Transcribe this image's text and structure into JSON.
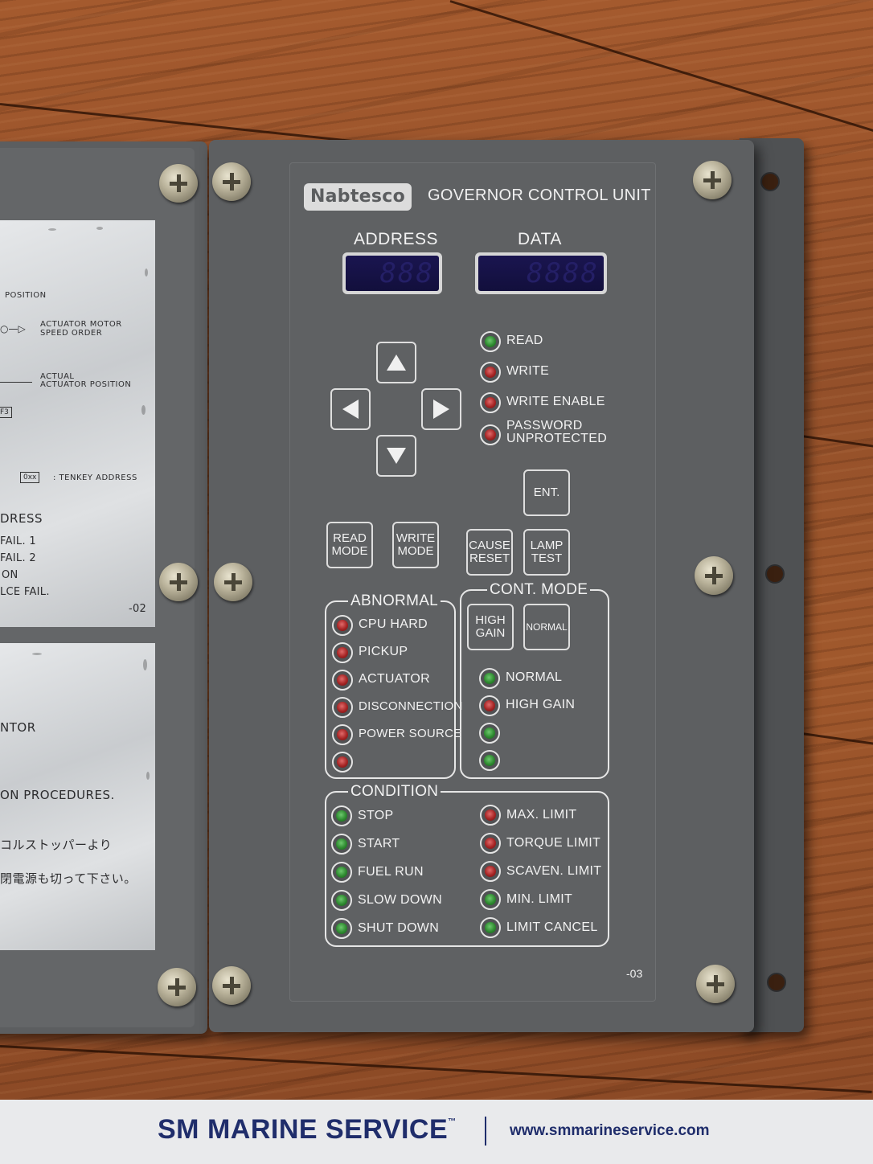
{
  "panel": {
    "brand_logo": "Nabtesco",
    "title": "GOVERNOR CONTROL UNIT",
    "address_label": "ADDRESS",
    "data_label": "DATA",
    "address_digits": "888",
    "data_digits": "8888",
    "panel_code": "-03",
    "status_leds": [
      {
        "label": "READ",
        "color": "green"
      },
      {
        "label": "WRITE",
        "color": "red"
      },
      {
        "label": "WRITE ENABLE",
        "color": "red"
      },
      {
        "label_line1": "PASSWORD",
        "label_line2": "UNPROTECTED",
        "color": "red"
      }
    ],
    "buttons": {
      "ent": "ENT.",
      "read_mode_1": "READ",
      "read_mode_2": "MODE",
      "write_mode_1": "WRITE",
      "write_mode_2": "MODE",
      "cause_reset_1": "CAUSE",
      "cause_reset_2": "RESET",
      "lamp_test_1": "LAMP",
      "lamp_test_2": "TEST",
      "high_gain_1": "HIGH",
      "high_gain_2": "GAIN",
      "normal": "NORMAL"
    },
    "abnormal": {
      "title": "ABNORMAL",
      "items": [
        {
          "label": "CPU HARD",
          "color": "red"
        },
        {
          "label": "PICKUP",
          "color": "red"
        },
        {
          "label": "ACTUATOR",
          "color": "red"
        },
        {
          "label": "DISCONNECTION",
          "color": "red"
        },
        {
          "label": "POWER SOURCE",
          "color": "red"
        },
        {
          "label": "",
          "color": "red"
        }
      ]
    },
    "cont_mode": {
      "title": "CONT. MODE",
      "items": [
        {
          "label": "NORMAL",
          "color": "green"
        },
        {
          "label": "HIGH GAIN",
          "color": "red"
        },
        {
          "label": "",
          "color": "green"
        },
        {
          "label": "",
          "color": "green"
        }
      ]
    },
    "condition": {
      "title": "CONDITION",
      "left": [
        {
          "label": "STOP",
          "color": "green"
        },
        {
          "label": "START",
          "color": "green"
        },
        {
          "label": "FUEL RUN",
          "color": "green"
        },
        {
          "label": "SLOW DOWN",
          "color": "green"
        },
        {
          "label": "SHUT DOWN",
          "color": "green"
        }
      ],
      "right": [
        {
          "label": "MAX. LIMIT",
          "color": "red"
        },
        {
          "label": "TORQUE LIMIT",
          "color": "red"
        },
        {
          "label": "SCAVEN. LIMIT",
          "color": "red"
        },
        {
          "label": "MIN. LIMIT",
          "color": "green"
        },
        {
          "label": "LIMIT CANCEL",
          "color": "green"
        }
      ]
    }
  },
  "left_plate_1": {
    "position": "POSITION",
    "motor_1": "ACTUATOR MOTOR",
    "motor_2": "SPEED ORDER",
    "actual_1": "ACTUAL",
    "actual_2": "ACTUATOR POSITION",
    "box_f3": "F3",
    "box_0xx": "0xx",
    "tenkey": ": TENKEY ADDRESS",
    "dress": "DRESS",
    "fail1": "FAIL. 1",
    "fail2": "FAIL. 2",
    "on": "ON",
    "lce_fail": "LCE FAIL.",
    "code": "-02"
  },
  "left_plate_2": {
    "ntor": "NTOR",
    "procedures": "ON PROCEDURES.",
    "jp1": "コルストッパーより",
    "jp2": "閉電源も切って下さい。"
  },
  "footer": {
    "brand": "SM MARINE SERVICE",
    "trademark": "™",
    "url": "www.smmarineservice.com"
  },
  "colors": {
    "panel": "#5f6163",
    "led_red": "#a52424",
    "led_green": "#2e8a30",
    "brand_blue": "#1f2d6b",
    "display": "#120f3c"
  }
}
